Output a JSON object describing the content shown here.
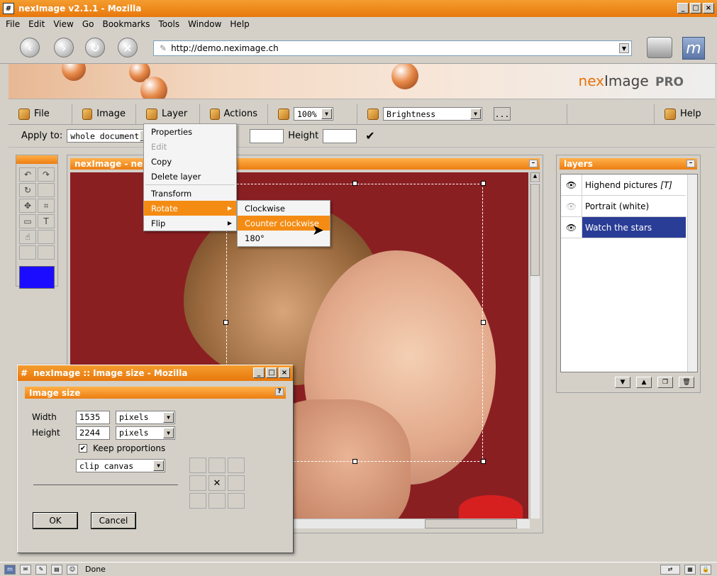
{
  "window": {
    "title": "nexImage v2.1.1 - Mozilla",
    "icon": "app-icon"
  },
  "menubar": [
    "File",
    "Edit",
    "View",
    "Go",
    "Bookmarks",
    "Tools",
    "Window",
    "Help"
  ],
  "url": "http://demo.neximage.ch",
  "brand": {
    "part1": "nex",
    "part2": "Image",
    "part3": "PRO"
  },
  "toolbar": {
    "file": "File",
    "image": "Image",
    "layer": "Layer",
    "actions": "Actions",
    "zoom": "100%",
    "filter": "Brightness",
    "more": "...",
    "help": "Help"
  },
  "applybar": {
    "label": "Apply to:",
    "value": "whole document",
    "height_label": "Height",
    "check": "✔"
  },
  "image_window": {
    "title": "nexImage - nexby"
  },
  "layer_menu": {
    "properties": "Properties",
    "edit": "Edit",
    "copy": "Copy",
    "delete": "Delete layer",
    "transform": "Transform",
    "rotate": "Rotate",
    "flip": "Flip"
  },
  "rotate_menu": {
    "cw": "Clockwise",
    "ccw": "Counter clockwise",
    "r180": "180°"
  },
  "layers": {
    "title": "layers",
    "items": [
      {
        "name": "Highend pictures",
        "tag": "[T]"
      },
      {
        "name": "Portrait (white)",
        "tag": ""
      },
      {
        "name": "Watch the stars",
        "tag": ""
      }
    ]
  },
  "dialog": {
    "title": "nexImage :: Image size - Mozilla",
    "header": "Image size",
    "help": "?",
    "width_label": "Width",
    "width_value": "1535",
    "width_unit": "pixels",
    "height_label": "Height",
    "height_value": "2244",
    "height_unit": "pixels",
    "keep": "Keep proportions",
    "mode": "clip canvas",
    "ok": "OK",
    "cancel": "Cancel"
  },
  "status": {
    "text": "Done"
  },
  "colors": {
    "accent": "#ec7d10",
    "fg_color": "#1b0cff",
    "selection": "#2a3d96"
  }
}
